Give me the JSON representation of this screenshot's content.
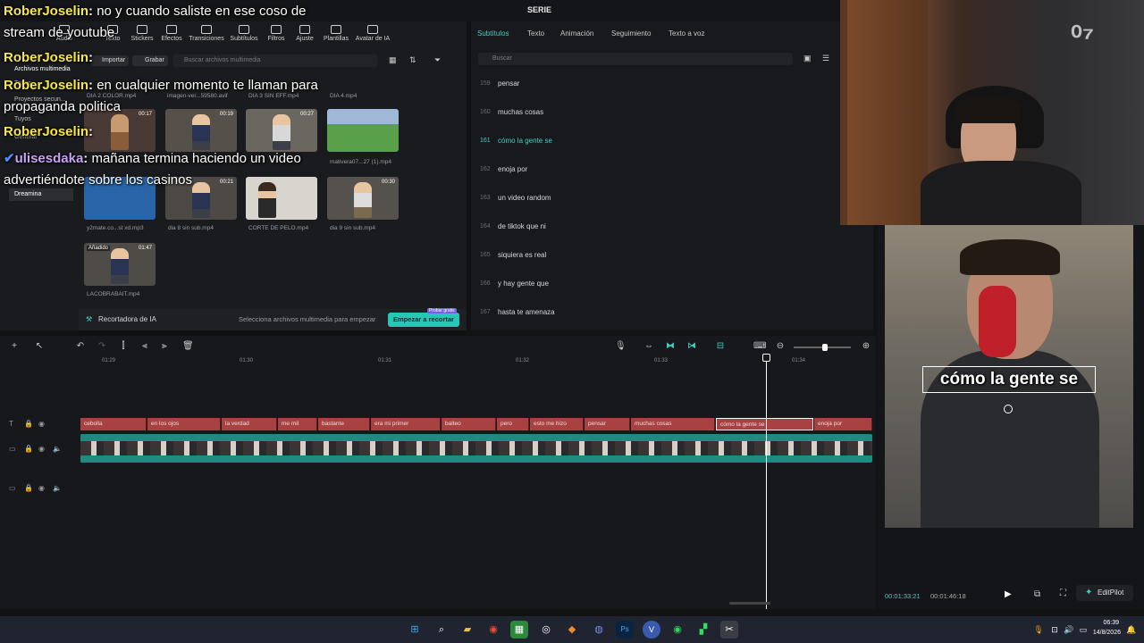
{
  "app": {
    "title": "SERIE"
  },
  "toolbar": {
    "items": [
      "Importar",
      "Audio",
      "Texto",
      "Stickers",
      "Efectos",
      "Transiciones",
      "Subtítulos",
      "Filtros",
      "Ajuste",
      "Plantillas",
      "Avatar de IA"
    ],
    "import_label": "Importar",
    "record_label": "Grabar",
    "search_placeholder": "Buscar archivos multimedia"
  },
  "sidenav": {
    "items": [
      "Archivos multimedia",
      "Todos",
      "Proyectos secun...",
      "Tuyos",
      "Generar",
      "Dreamina"
    ]
  },
  "media": {
    "top_names": [
      "DIA 2 COLOR.mp4",
      "imagen-ver...59580.avif",
      "DIA 3 SIN EFF.mp4",
      "DIA 4.mp4"
    ],
    "items": [
      {
        "name": "",
        "duration": "00:17"
      },
      {
        "name": "",
        "duration": "00:19"
      },
      {
        "name": "",
        "duration": "00:27"
      },
      {
        "name": "mativera07...27 (1).mp4",
        "duration": ""
      },
      {
        "name": "y2mate.co...st xd.mp3",
        "duration": ""
      },
      {
        "name": "dia 8 sin sub.mp4",
        "duration": "00:21"
      },
      {
        "name": "CORTE DE PELO.mp4",
        "duration": ""
      },
      {
        "name": "dia 9 sin sub.mp4",
        "duration": "00:30"
      },
      {
        "name": "LACOBRABAIT.mp4",
        "duration": "01:47",
        "tag": "Añadido"
      }
    ]
  },
  "ai_cut": {
    "label": "Recortadora de IA",
    "hint": "Selecciona archivos multimedia para empezar",
    "button": "Empezar a recortar",
    "badge": "Probar gratis"
  },
  "subtitles": {
    "tabs": [
      "Subtítulos",
      "Texto",
      "Animación",
      "Seguimiento",
      "Texto a voz"
    ],
    "search_placeholder": "Buscar",
    "rows": [
      {
        "num": "159",
        "text": "pensar"
      },
      {
        "num": "160",
        "text": "muchas cosas"
      },
      {
        "num": "161",
        "text": "cómo la gente se",
        "active": true
      },
      {
        "num": "162",
        "text": "enoja por"
      },
      {
        "num": "163",
        "text": "un video random"
      },
      {
        "num": "164",
        "text": "de tiktok que ni"
      },
      {
        "num": "165",
        "text": "siquiera es real"
      },
      {
        "num": "166",
        "text": "y hay gente que"
      },
      {
        "num": "167",
        "text": "hasta te amenaza"
      }
    ]
  },
  "timeline": {
    "ruler": [
      "01:29",
      "01:30",
      "01:31",
      "01:32",
      "01:33",
      "01:34"
    ],
    "clips": [
      "cebolla",
      "en los ojos",
      "la verdad",
      "me mil",
      "bastante",
      "era mi primer",
      "balteo",
      "pero",
      "esto me hizo",
      "pensar",
      "muchas cosas",
      "cómo la gente se",
      "enoja por"
    ]
  },
  "preview": {
    "caption": "cómo la gente se",
    "current_time": "00:01:33:21",
    "total_time": "00:01:46:18",
    "editpilot": "EditPilot"
  },
  "chat": [
    {
      "user": "RoberJoselin",
      "msg": "no y cuando saliste en ese coso de"
    },
    {
      "user": "",
      "msg": "stream de youtube"
    },
    {
      "user": "RoberJoselin",
      "msg": ""
    },
    {
      "user": "RoberJoselin",
      "msg": "en cualquier momento te llaman para"
    },
    {
      "user": "",
      "msg": "propaganda politica"
    },
    {
      "user": "RoberJoselin",
      "msg": ""
    },
    {
      "user": "ulisesdaka",
      "msg": "mañana termina haciendo un video"
    },
    {
      "user": "",
      "msg": "advertiéndote sobre los casinos"
    }
  ],
  "taskbar": {
    "time": "06:39",
    "date": "14/8/2026"
  },
  "colors": {
    "accent": "#3ed0c3",
    "subtitle_clip": "#a84242",
    "video_track": "#1f8a82"
  }
}
